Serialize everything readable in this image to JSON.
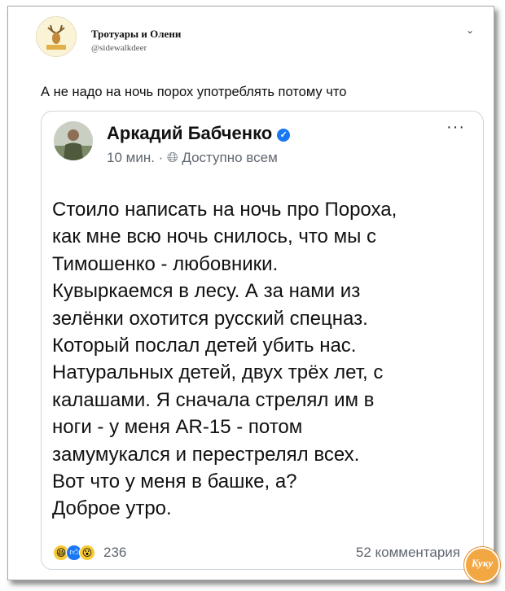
{
  "colors": {
    "frame_border": "#a8a8a8",
    "card_border": "#cfd6dc",
    "fb_blue": "#1877f2",
    "meta_gray": "#606770",
    "reaction_yellow": "#f7c935",
    "badge_orange": "#f2a743"
  },
  "tweet": {
    "author_name": "Тротуары и Олени",
    "author_handle": "@sidewalkdeer",
    "text": "А не надо на ночь порох употреблять потому что",
    "menu_icon": "chevron-down-icon"
  },
  "post": {
    "author_name": "Аркадий Бабченко",
    "verified_icon": "verified-check-icon",
    "time": "10 мин. ·",
    "privacy_icon": "globe-icon",
    "visibility": "Доступно всем",
    "more_icon": "more-dots-icon",
    "more_label": "···",
    "lines": [
      "Стоило написать на ночь про Пороха,",
      "как мне всю ночь снилось, что мы с",
      "Тимошенко - любовники.",
      "Кувыркаемся в лесу. А за нами из",
      "зелёнки охотится русский спецназ.",
      "Который послал детей убить нас.",
      "Натуральных детей, двух трёх лет, с",
      "калашами. Я сначала стрелял им в",
      "ноги - у меня AR-15 - потом",
      "замумукался и перестрелял всех.",
      "Вот что у меня в башке, а?",
      "Доброе утро."
    ],
    "reactions": [
      "haha-icon",
      "like-icon",
      "wow-icon"
    ],
    "reaction_count": "236",
    "comments": "52 комментария"
  }
}
